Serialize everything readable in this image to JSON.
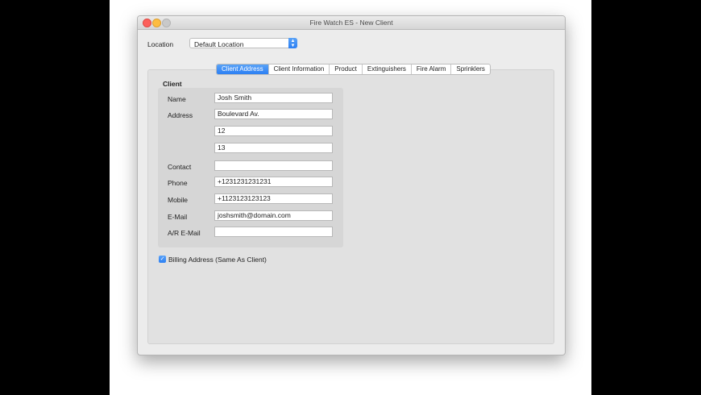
{
  "window": {
    "title": "Fire Watch ES - New Client"
  },
  "location": {
    "label": "Location",
    "value": "Default Location"
  },
  "tabs": [
    "Client Address",
    "Client Information",
    "Product",
    "Extinguishers",
    "Fire Alarm",
    "Sprinklers"
  ],
  "client": {
    "group_label": "Client",
    "fields": {
      "name": {
        "label": "Name",
        "value": "Josh Smith"
      },
      "address": {
        "label": "Address",
        "lines": [
          "Boulevard Av.",
          "12",
          "13"
        ]
      },
      "contact": {
        "label": "Contact",
        "value": ""
      },
      "phone": {
        "label": "Phone",
        "value": "+1231231231231"
      },
      "mobile": {
        "label": "Mobile",
        "value": "+1123123123123"
      },
      "email": {
        "label": "E-Mail",
        "value": "joshsmith@domain.com"
      },
      "ar_email": {
        "label": "A/R E-Mail",
        "value": ""
      }
    }
  },
  "billing": {
    "label": "Billing Address (Same As Client)",
    "checked": true
  },
  "colors": {
    "accent": "#2f83f4",
    "window_bg": "#ececec",
    "panel_bg": "#e1e1e1"
  },
  "icons": {
    "select_arrows": "updown-chevron-icon",
    "checkbox": "checkmark-icon"
  }
}
